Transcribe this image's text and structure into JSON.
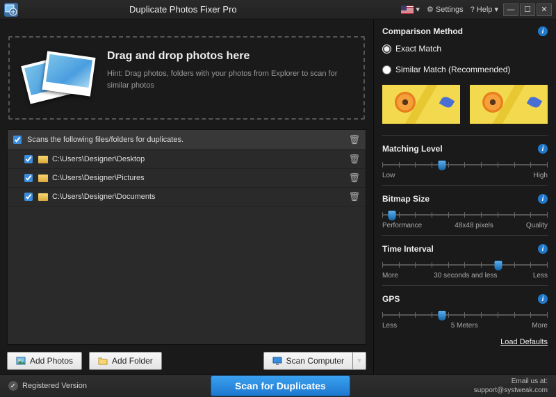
{
  "titlebar": {
    "title": "Duplicate Photos Fixer Pro",
    "settings": "Settings",
    "help": "? Help",
    "lang_arrow": "▾"
  },
  "dropzone": {
    "heading": "Drag and drop photos here",
    "hint": "Hint: Drag photos, folders with your photos from Explorer to scan for similar photos"
  },
  "filelist": {
    "header": "Scans the following files/folders for duplicates.",
    "rows": [
      {
        "path": "C:\\Users\\Designer\\Desktop"
      },
      {
        "path": "C:\\Users\\Designer\\Pictures"
      },
      {
        "path": "C:\\Users\\Designer\\Documents"
      }
    ]
  },
  "buttons": {
    "add_photos": "Add Photos",
    "add_folder": "Add Folder",
    "scan_computer": "Scan Computer"
  },
  "right": {
    "comparison_title": "Comparison Method",
    "exact": "Exact Match",
    "similar": "Similar Match (Recommended)",
    "matching_level": {
      "title": "Matching Level",
      "low": "Low",
      "high": "High",
      "pos": 36
    },
    "bitmap": {
      "title": "Bitmap Size",
      "low": "Performance",
      "mid": "48x48 pixels",
      "high": "Quality",
      "pos": 6
    },
    "time": {
      "title": "Time Interval",
      "low": "More",
      "mid": "30 seconds and less",
      "high": "Less",
      "pos": 70
    },
    "gps": {
      "title": "GPS",
      "low": "Less",
      "mid": "5 Meters",
      "high": "More",
      "pos": 36
    },
    "load_defaults": "Load Defaults"
  },
  "footer": {
    "registered": "Registered Version",
    "scan": "Scan for Duplicates",
    "email_label": "Email us at:",
    "email": "support@systweak.com"
  }
}
